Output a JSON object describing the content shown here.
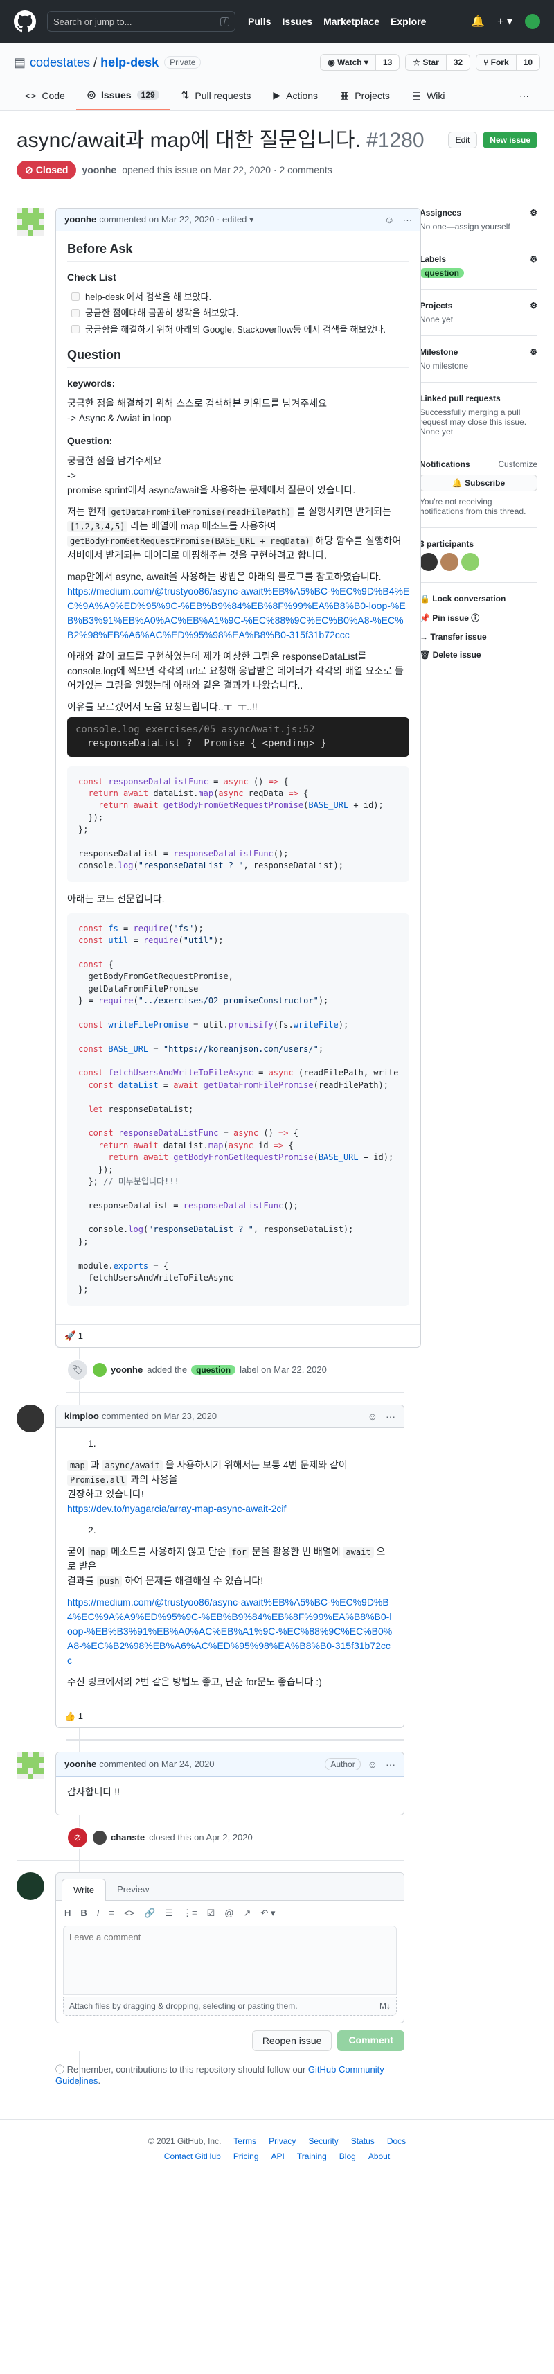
{
  "header": {
    "search_placeholder": "Search or jump to...",
    "slash": "/",
    "nav": [
      "Pulls",
      "Issues",
      "Marketplace",
      "Explore"
    ],
    "bell": "🔔",
    "plus": "+ ▾"
  },
  "repo": {
    "owner": "codestates",
    "sep": " / ",
    "name": "help-desk",
    "visibility": "Private",
    "watch_label": "◉ Watch ▾",
    "watch_count": "13",
    "star_label": "☆ Star",
    "star_count": "32",
    "fork_label": "⑂ Fork",
    "fork_count": "10",
    "tabs": [
      {
        "label": "Code",
        "icon": "<>"
      },
      {
        "label": "Issues",
        "icon": "◎",
        "count": "129"
      },
      {
        "label": "Pull requests",
        "icon": "⇅"
      },
      {
        "label": "Actions",
        "icon": "▶"
      },
      {
        "label": "Projects",
        "icon": "▦"
      },
      {
        "label": "Wiki",
        "icon": "▤"
      }
    ],
    "more": "···"
  },
  "issue": {
    "title": "async/await과 map에 대한 질문입니다.",
    "number": "#1280",
    "edit": "Edit",
    "new_issue": "New issue",
    "state": "Closed",
    "author": "yoonhe",
    "meta": "opened this issue on Mar 22, 2020 · 2 comments"
  },
  "c1": {
    "author": "yoonhe",
    "meta": "commented on Mar 22, 2020 · edited ▾",
    "h_before": "Before Ask",
    "h_check": "Check List",
    "tasks": [
      "help-desk 에서 검색을 해 보았다.",
      "궁금한 점에대해 곰곰히 생각을 해보았다.",
      "궁금함을 해결하기 위해 아래의 Google, Stackoverflow등 에서 검색을 해보았다."
    ],
    "h_question": "Question",
    "h_keywords": "keywords:",
    "kw_line1": "궁금한 점을 해결하기 위해 스스로 검색해본 키워드를 남겨주세요",
    "kw_line2": "-> Async & Awiat in loop",
    "h_q2": "Question:",
    "q_line1": "궁금한 점을 남겨주세요",
    "q_line2": "->",
    "q_line3": "promise sprint에서 async/await을 사용하는 문제에서 질문이 있습니다.",
    "p1_a": "저는 현재 ",
    "p1_code1": "getDataFromFilePromise(readFilePath)",
    "p1_b": " 를 실행시키면 반게되는 ",
    "p1_code2": "[1,2,3,4,5]",
    "p1_c": " 라는 배열에 map 메소드를 사용하여 ",
    "p1_code3": "getBodyFromGetRequestPromise(BASE_URL + reqData)",
    "p1_d": " 해당 함수를 실행하여 서버에서 받게되는 데이터로 매핑해주는 것을 구현하려고 합니다.",
    "p2": "map안에서 async, await을 사용하는 방법은 아래의 블로그를 참고하였습니다.",
    "link": "https://medium.com/@trustyoo86/async-await%EB%A5%BC-%EC%9D%B4%EC%9A%A9%ED%95%9C-%EB%B9%84%EB%8F%99%EA%B8%B0-loop-%EB%B3%91%EB%A0%AC%EB%A1%9C-%EC%88%9C%EC%B0%A8-%EC%B2%98%EB%A6%AC%ED%95%98%EA%B8%B0-315f31b72ccc",
    "p3": "아래와 같이 코드를 구현하였는데 제가 예상한 그림은 responseDataList를 console.log에 찍으면 각각의 url로 요청해 응답받은 데이터가 각각의 배열 요소로 들어가있는 그림을 원했는데 아래와 같은 결과가 나왔습니다..",
    "p4": "이유를 모르겠어서 도움 요청드립니다..ㅜ_ㅜ..!!",
    "dark_line1": "console.log exercises/05 asyncAwait.js:52",
    "dark_line2": "  responseDataList ?  Promise { <pending> }",
    "p5": "아래는 코드 전문입니다.",
    "reaction": "🚀 1"
  },
  "event1": {
    "actor": "yoonhe",
    "before": "added the",
    "label": "question",
    "after": "label on Mar 22, 2020"
  },
  "c2": {
    "author": "kimploo",
    "meta": "commented on Mar 23, 2020",
    "n1": "1.",
    "l1_a": "map",
    "l1_b": " 과 ",
    "l1_c": "async/await",
    "l1_d": " 을 사용하시기 위해서는 보통 4번 문제와 같이 ",
    "l1_e": "Promise.all",
    "l1_f": " 과의 사용을",
    "l2": "권장하고 있습니다!",
    "link1": "https://dev.to/nyagarcia/array-map-async-await-2cif",
    "n2": "2.",
    "m_a": "굳이 ",
    "m_b": "map",
    "m_c": " 메소드를 사용하지 않고 단순 ",
    "m_d": "for",
    "m_e": " 문을 활용한 빈 배열에 ",
    "m_f": "await",
    "m_g": " 으로 받은",
    "m2_a": "결과를 ",
    "m2_b": "push",
    "m2_c": " 하여 문제를 해결해실 수 있습니다!",
    "link2": "https://medium.com/@trustyoo86/async-await%EB%A5%BC-%EC%9D%B4%EC%9A%A9%ED%95%9C-%EB%B9%84%EB%8F%99%EA%B8%B0-loop-%EB%B3%91%EB%A0%AC%EB%A1%9C-%EC%88%9C%EC%B0%A8-%EC%B2%98%EB%A6%AC%ED%95%98%EA%B8%B0-315f31b72ccc",
    "closing": "주신 링크에서의 2번 같은 방법도 좋고, 단순 for문도 좋습니다 :)",
    "reaction": "👍 1"
  },
  "c3": {
    "author": "yoonhe",
    "meta": "commented on Mar 24, 2020",
    "badge": "Author",
    "body": "감사합니다 !!"
  },
  "event2": {
    "actor": "chanste",
    "text": "closed this on Apr 2, 2020"
  },
  "editor": {
    "tab_write": "Write",
    "tab_preview": "Preview",
    "tools": [
      "H",
      "B",
      "I",
      "≡",
      "<>",
      "🔗",
      "☰",
      "⋮≡",
      "☑",
      "@",
      "↗",
      "↶ ▾"
    ],
    "placeholder": "Leave a comment",
    "attach": "Attach files by dragging & dropping, selecting or pasting them.",
    "md": "M↓",
    "reopen": "Reopen issue",
    "comment": "Comment"
  },
  "tip": {
    "prefix": "ⓘ Remember, contributions to this repository should follow our ",
    "link": "GitHub Community Guidelines",
    "suffix": "."
  },
  "sidebar": {
    "assignees_title": "Assignees",
    "assignees_value": "No one—assign yourself",
    "labels_title": "Labels",
    "label": "question",
    "projects_title": "Projects",
    "projects_value": "None yet",
    "milestone_title": "Milestone",
    "milestone_value": "No milestone",
    "linked_title": "Linked pull requests",
    "linked_value": "Successfully merging a pull request may close this issue.",
    "linked_extra": "None yet",
    "notif_title": "Notifications",
    "customize": "Customize",
    "subscribe": "🔔 Subscribe",
    "notif_value": "You're not receiving notifications from this thread.",
    "participants": "3 participants",
    "lock": "🔒 Lock conversation",
    "pin": "📌 Pin issue ⓘ",
    "transfer": "→ Transfer issue",
    "delete": "🗑 Delete issue",
    "gear": "⚙"
  },
  "footer": {
    "copy": "© 2021 GitHub, Inc.",
    "row1": [
      "Terms",
      "Privacy",
      "Security",
      "Status",
      "Docs"
    ],
    "row2": [
      "Contact GitHub",
      "Pricing",
      "API",
      "Training",
      "Blog",
      "About"
    ]
  },
  "colors": {
    "header": "#24292e",
    "closed": "#d73a49",
    "label": "#7ce08a",
    "link": "#0366d6"
  }
}
